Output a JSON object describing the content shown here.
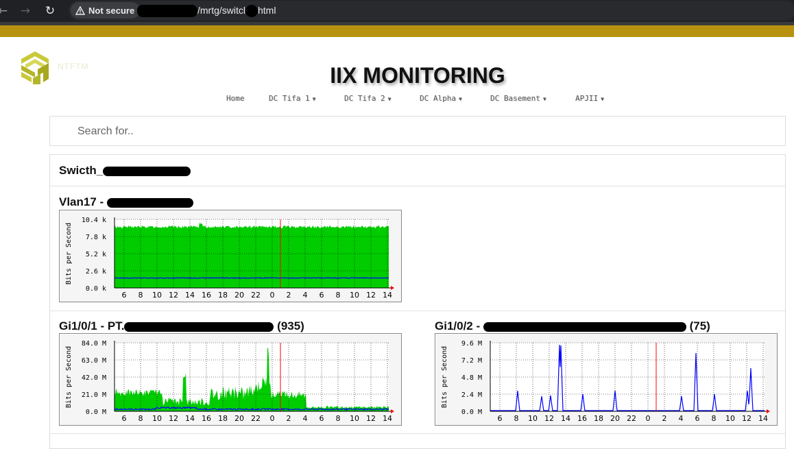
{
  "browser": {
    "security_label": "Not secure",
    "url_path": "/mrtg/switcl",
    "url_ext": "html"
  },
  "logo": {
    "text": "NTFTM"
  },
  "page": {
    "title": "IIX MONITORING"
  },
  "menu": [
    {
      "label": "Home",
      "dropdown": false
    },
    {
      "label": "DC Tifa 1",
      "dropdown": true
    },
    {
      "label": "DC Tifa 2",
      "dropdown": true
    },
    {
      "label": "DC Alpha",
      "dropdown": true
    },
    {
      "label": "DC Basement",
      "dropdown": true
    },
    {
      "label": "APJII",
      "dropdown": true
    }
  ],
  "search": {
    "placeholder": "Search for.."
  },
  "device": {
    "name_prefix": "Swicth_"
  },
  "graphs": [
    {
      "title_prefix": "Vlan17 - ",
      "title_suffix": "",
      "ylabel": "Bits per Second",
      "yticks": [
        "0.0 k",
        "2.6 k",
        "5.2 k",
        "7.8 k",
        "10.4 k"
      ],
      "xticks": [
        "6",
        "8",
        "10",
        "12",
        "14",
        "16",
        "18",
        "20",
        "22",
        "0",
        "2",
        "4",
        "6",
        "8",
        "10",
        "12",
        "14"
      ],
      "in_color": "#00cc00",
      "out_color": "#0000ff"
    },
    {
      "title_prefix": "Gi1/0/1 - PT.",
      "title_suffix": " (935)",
      "ylabel": "Bits per Second",
      "yticks": [
        "0.0 M",
        "21.0 M",
        "42.0 M",
        "63.0 M",
        "84.0 M"
      ],
      "xticks": [
        "6",
        "8",
        "10",
        "12",
        "14",
        "16",
        "18",
        "20",
        "22",
        "0",
        "2",
        "4",
        "6",
        "8",
        "10",
        "12",
        "14"
      ],
      "in_color": "#00cc00",
      "out_color": "#0000ff"
    },
    {
      "title_prefix": "Gi1/0/2 - ",
      "title_suffix": " (75)",
      "ylabel": "Bits per Second",
      "yticks": [
        "0.0 M",
        "2.4 M",
        "4.8 M",
        "7.2 M",
        "9.6 M"
      ],
      "xticks": [
        "6",
        "8",
        "10",
        "12",
        "14",
        "16",
        "18",
        "20",
        "22",
        "0",
        "2",
        "4",
        "6",
        "8",
        "10",
        "12",
        "14"
      ],
      "in_color": "#00cc00",
      "out_color": "#0000ff"
    }
  ]
}
